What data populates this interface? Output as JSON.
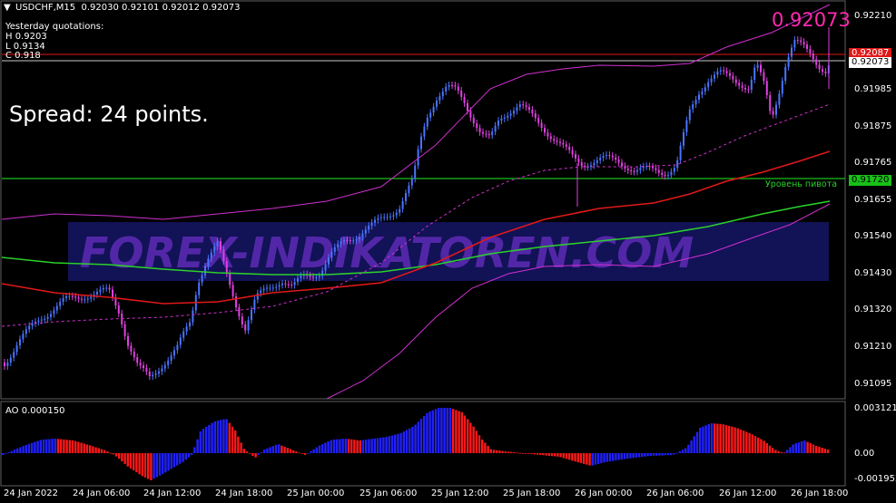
{
  "header": {
    "symbol_tf": "USDCHF,M15",
    "ohlc": "0.92030 0.92101 0.92012 0.92073"
  },
  "yesterday": {
    "title": "Yesterday quotations:",
    "high": "H 0.9203",
    "low": "L 0.9134",
    "close": "C 0.918"
  },
  "spread_text": "Spread: 24 points.",
  "big_price": "0.92073",
  "watermark": "FOREX-INDIKATOREN.COM",
  "pivot_label": "Уровень пивота",
  "price_axis": [
    "0.92210",
    "0.91985",
    "0.91875",
    "0.91765",
    "0.91655",
    "0.91540",
    "0.91430",
    "0.91320",
    "0.91210",
    "0.91095"
  ],
  "tag_red": "0.92087",
  "tag_current": "0.92073",
  "tag_pivot": "0.91720",
  "ao": {
    "label": "AO 0.000150",
    "axis": [
      "0.003121",
      "0.00",
      "-0.001952"
    ]
  },
  "time_axis": [
    "24 Jan 2022",
    "24 Jan 06:00",
    "24 Jan 12:00",
    "24 Jan 18:00",
    "25 Jan 00:00",
    "25 Jan 06:00",
    "25 Jan 12:00",
    "25 Jan 18:00",
    "26 Jan 00:00",
    "26 Jan 06:00",
    "26 Jan 12:00",
    "26 Jan 18:00"
  ],
  "colors": {
    "bg": "#000000",
    "bull": "#4a74ff",
    "bear": "#e040e0",
    "ma_green": "#2ad02a",
    "ma_red": "#e01818",
    "band": "#d030d0",
    "pivot": "#18c018",
    "ao_up": "#2020ff",
    "ao_down": "#ff1818",
    "big_price": "#ff2ab0"
  }
}
